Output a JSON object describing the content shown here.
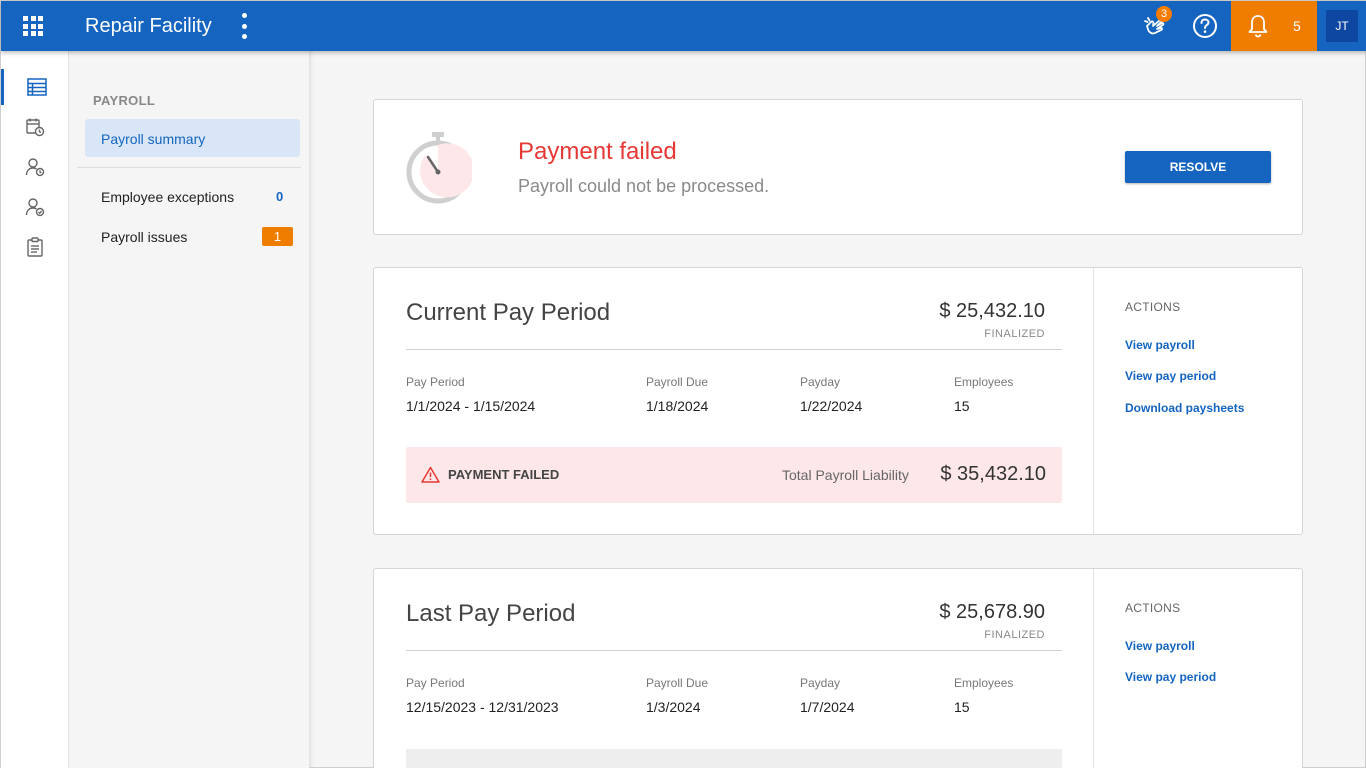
{
  "app": {
    "title": "Repair Facility",
    "celebrate_badge": "3",
    "notification_count": "5",
    "avatar_initials": "JT",
    "brand_color": "#1565c0",
    "accent_color": "#ef7d00"
  },
  "rail": {
    "icons": [
      "list-view-icon",
      "calendar-clock-icon",
      "user-clock-icon",
      "user-check-icon",
      "clipboard-icon"
    ],
    "active_index": 0
  },
  "subnav": {
    "section": "PAYROLL",
    "active_item": "Payroll summary",
    "items": [
      {
        "label": "Employee exceptions",
        "count": "0"
      },
      {
        "label": "Payroll issues",
        "count": "1"
      }
    ]
  },
  "alert": {
    "title": "Payment failed",
    "subtitle": "Payroll could not be processed.",
    "button": "RESOLVE",
    "icon": "stopwatch-icon"
  },
  "current_period": {
    "title": "Current Pay Period",
    "amount": "$ 25,432.10",
    "status": "FINALIZED",
    "fields": [
      {
        "label": "Pay Period",
        "value": "1/1/2024 - 1/15/2024"
      },
      {
        "label": "Payroll Due",
        "value": "1/18/2024"
      },
      {
        "label": "Payday",
        "value": "1/22/2024"
      },
      {
        "label": "Employees",
        "value": "15"
      }
    ],
    "failure_label": "PAYMENT FAILED",
    "liability_label": "Total Payroll Liability",
    "liability_amount": "$ 35,432.10",
    "actions_heading": "ACTIONS",
    "actions": [
      "View payroll",
      "View pay period",
      "Download paysheets"
    ]
  },
  "last_period": {
    "title": "Last Pay Period",
    "amount": "$ 25,678.90",
    "status": "FINALIZED",
    "fields": [
      {
        "label": "Pay Period",
        "value": "12/15/2023 - 12/31/2023"
      },
      {
        "label": "Payroll Due",
        "value": "1/3/2024"
      },
      {
        "label": "Payday",
        "value": "1/7/2024"
      },
      {
        "label": "Employees",
        "value": "15"
      }
    ],
    "actions_heading": "ACTIONS",
    "actions": [
      "View payroll",
      "View pay period"
    ]
  }
}
